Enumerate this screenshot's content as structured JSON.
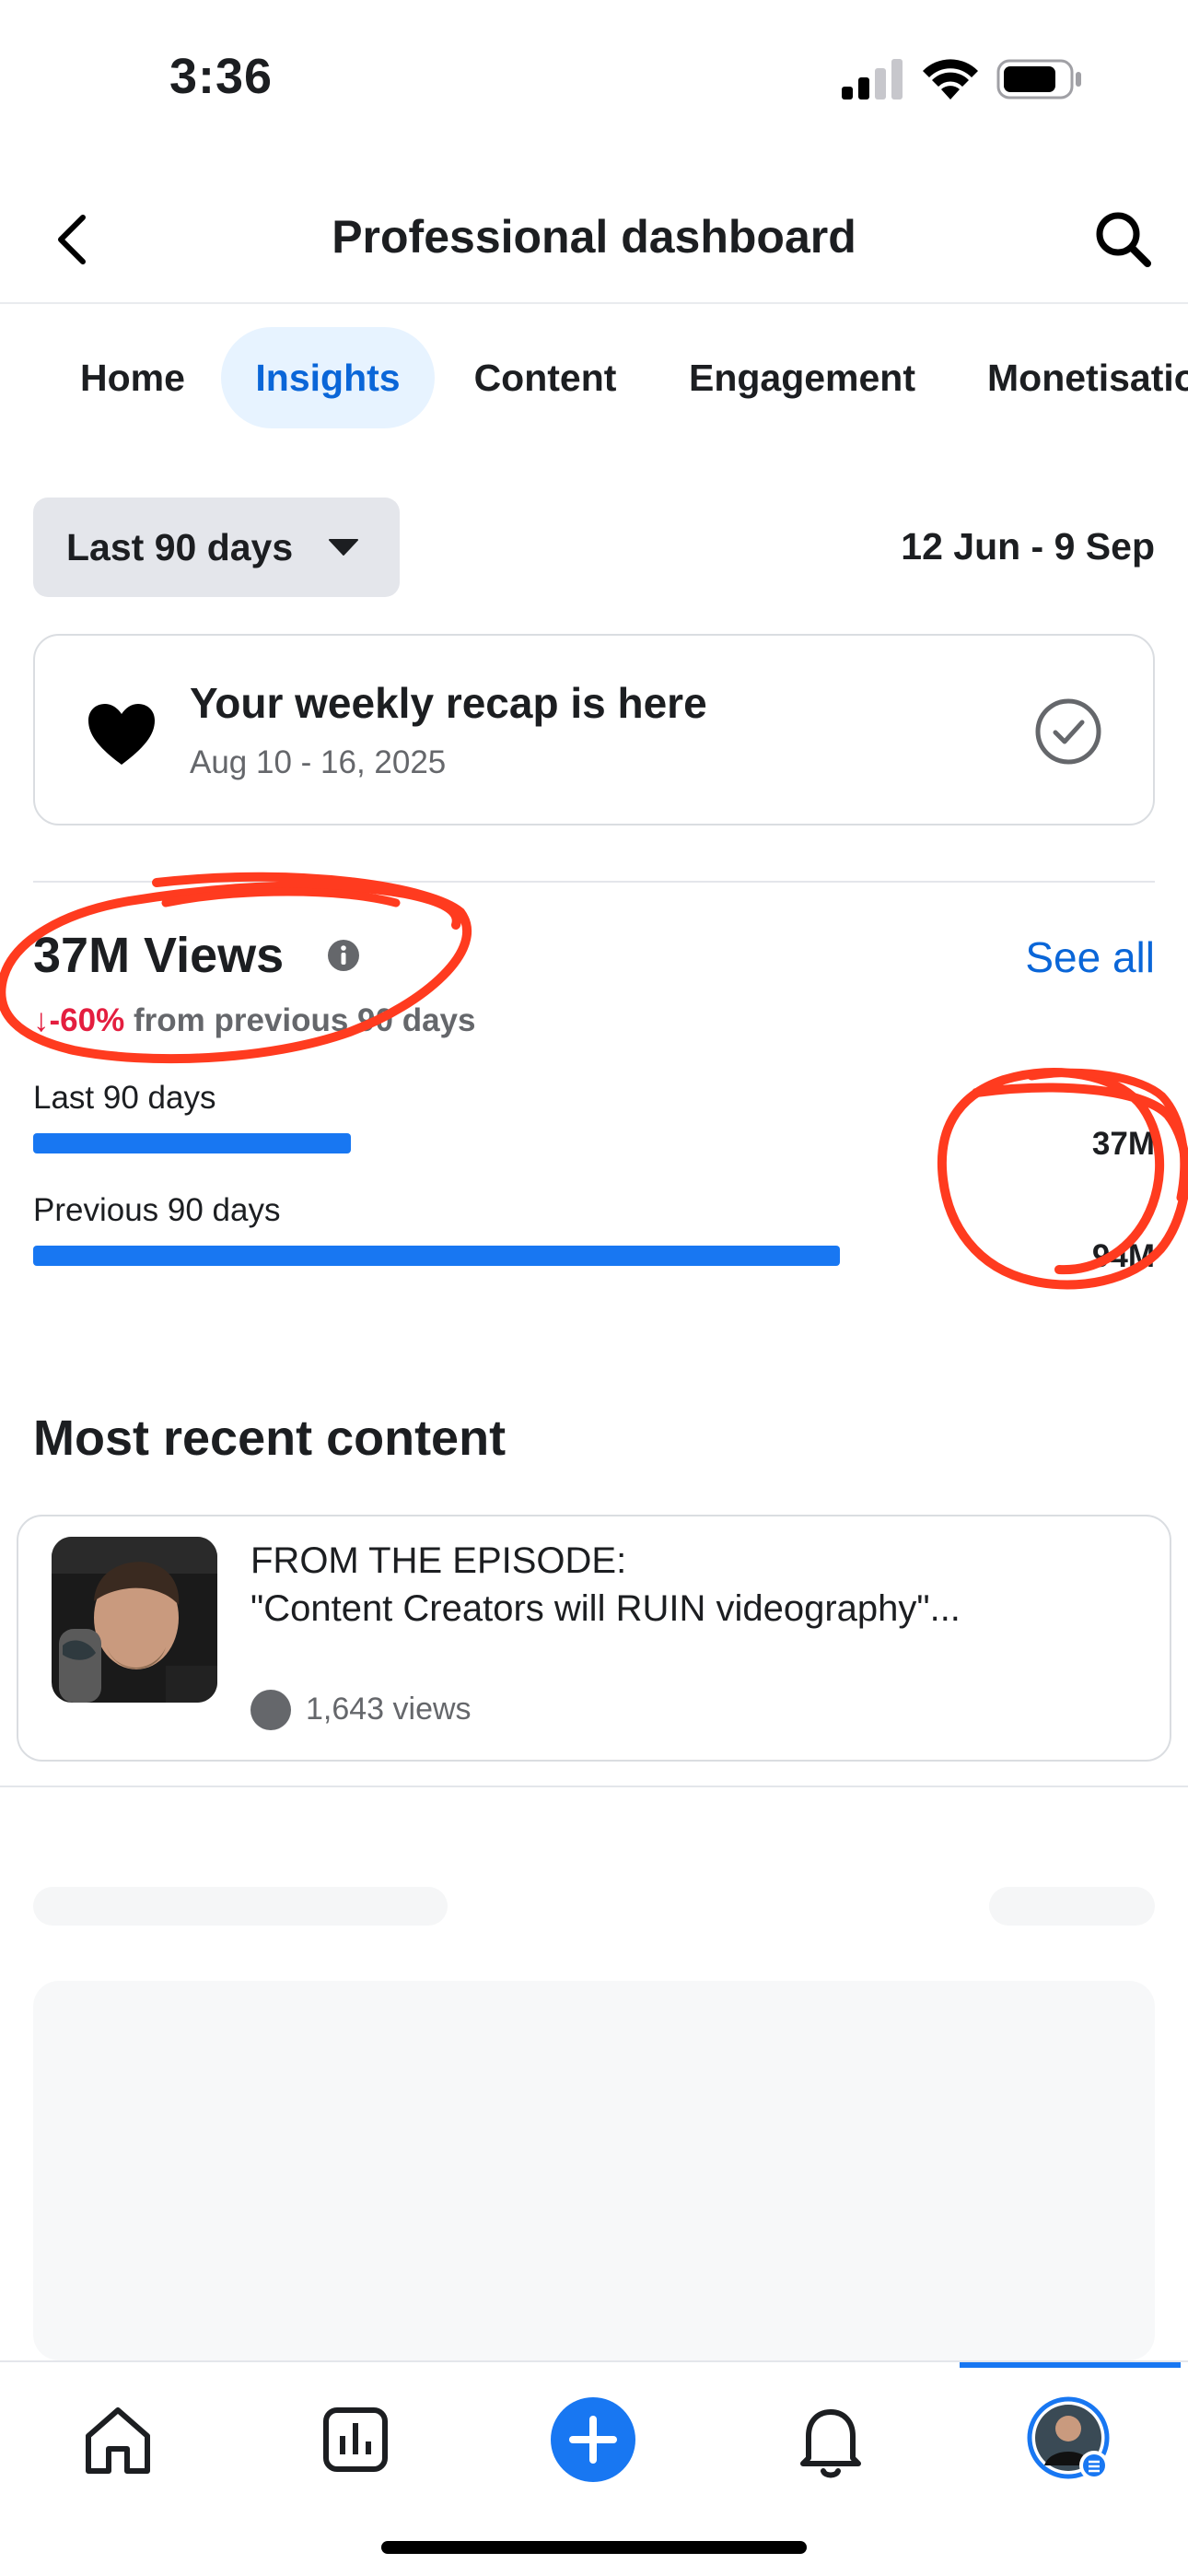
{
  "status_bar": {
    "time": "3:36"
  },
  "header": {
    "title": "Professional dashboard"
  },
  "tabs": [
    {
      "label": "Home"
    },
    {
      "label": "Insights"
    },
    {
      "label": "Content"
    },
    {
      "label": "Engagement"
    },
    {
      "label": "Monetisation"
    }
  ],
  "tabs_active": "Insights",
  "filter": {
    "range_label": "Last 90 days",
    "date_range": "12 Jun - 9 Sep"
  },
  "recap": {
    "title": "Your weekly recap is here",
    "date": "Aug 10 - 16, 2025"
  },
  "views": {
    "title": "37M Views",
    "delta_arrow": "↓",
    "delta_value": "-60%",
    "delta_text": " from previous 90 days",
    "see_all": "See all",
    "bars": [
      {
        "label": "Last 90 days",
        "value": "37M",
        "fraction": 0.394
      },
      {
        "label": "Previous 90 days",
        "value": "94M",
        "fraction": 1.0
      }
    ]
  },
  "recent": {
    "title": "Most recent content",
    "item": {
      "line1": "FROM THE EPISODE:",
      "line2": "\"Content Creators will RUIN videography\"...",
      "views": "1,643 views"
    }
  },
  "colors": {
    "accent": "#1877f2",
    "link": "#0a66d8",
    "negative": "#e41e3f",
    "annotation": "#ff3b1f"
  },
  "bottom_nav": [
    "home-icon",
    "insights-icon",
    "create-icon",
    "notifications-icon",
    "profile-avatar"
  ]
}
